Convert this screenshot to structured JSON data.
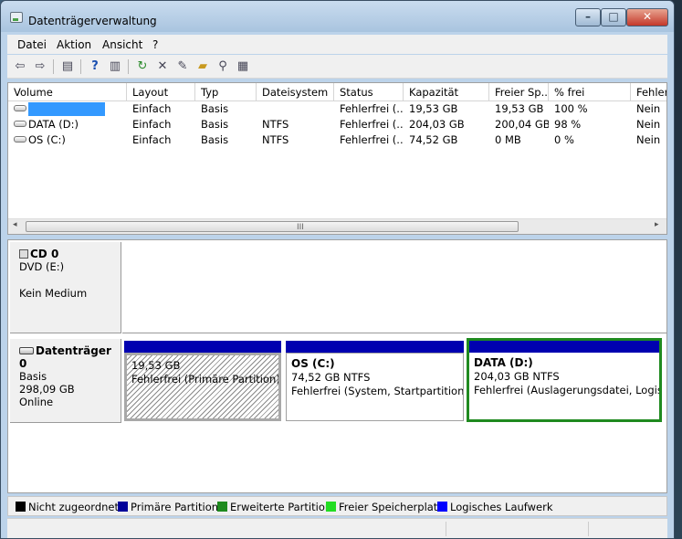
{
  "window": {
    "title": "Datenträgerverwaltung"
  },
  "menu": [
    "Datei",
    "Aktion",
    "Ansicht",
    "?"
  ],
  "toolbar_icons": [
    "back-arrow-icon",
    "forward-arrow-icon",
    "properties-icon",
    "help-icon",
    "view-icon",
    "refresh-icon",
    "delete-icon",
    "settings-icon",
    "open-folder-icon",
    "search-icon",
    "rescan-icon"
  ],
  "columns": [
    "Volume",
    "Layout",
    "Typ",
    "Dateisystem",
    "Status",
    "Kapazität",
    "Freier Sp...",
    "% frei",
    "Fehler"
  ],
  "volumes": [
    {
      "name": "",
      "layout": "Einfach",
      "type": "Basis",
      "fs": "",
      "status": "Fehlerfrei (...",
      "capacity": "19,53 GB",
      "free": "19,53 GB",
      "pct": "100 %",
      "fault": "Nein"
    },
    {
      "name": "DATA (D:)",
      "layout": "Einfach",
      "type": "Basis",
      "fs": "NTFS",
      "status": "Fehlerfrei (...",
      "capacity": "204,03 GB",
      "free": "200,04 GB",
      "pct": "98 %",
      "fault": "Nein"
    },
    {
      "name": "OS (C:)",
      "layout": "Einfach",
      "type": "Basis",
      "fs": "NTFS",
      "status": "Fehlerfrei (...",
      "capacity": "74,52 GB",
      "free": "0 MB",
      "pct": "0 %",
      "fault": "Nein"
    }
  ],
  "scroll_grip": "III",
  "cd": {
    "name": "CD 0",
    "type": "DVD (E:)",
    "state": "Kein Medium"
  },
  "disk": {
    "name": "Datenträger 0",
    "type": "Basis",
    "size": "298,09 GB",
    "state": "Online"
  },
  "partitions": [
    {
      "name": "",
      "size": "19,53 GB",
      "status": "Fehlerfrei (Primäre Partition)"
    },
    {
      "name": "OS  (C:)",
      "size": "74,52 GB NTFS",
      "status": "Fehlerfrei (System, Startpartition, Ak"
    },
    {
      "name": "DATA  (D:)",
      "size": "204,03 GB NTFS",
      "status": "Fehlerfrei (Auslagerungsdatei, Logisch"
    }
  ],
  "legend": [
    {
      "label": "Nicht zugeordnet",
      "color": "#000000"
    },
    {
      "label": "Primäre Partition",
      "color": "#000099"
    },
    {
      "label": "Erweiterte Partition",
      "color": "#1f8a1f"
    },
    {
      "label": "Freier Speicherplatz",
      "color": "#22dd22"
    },
    {
      "label": "Logisches Laufwerk",
      "color": "#0000ff"
    }
  ]
}
